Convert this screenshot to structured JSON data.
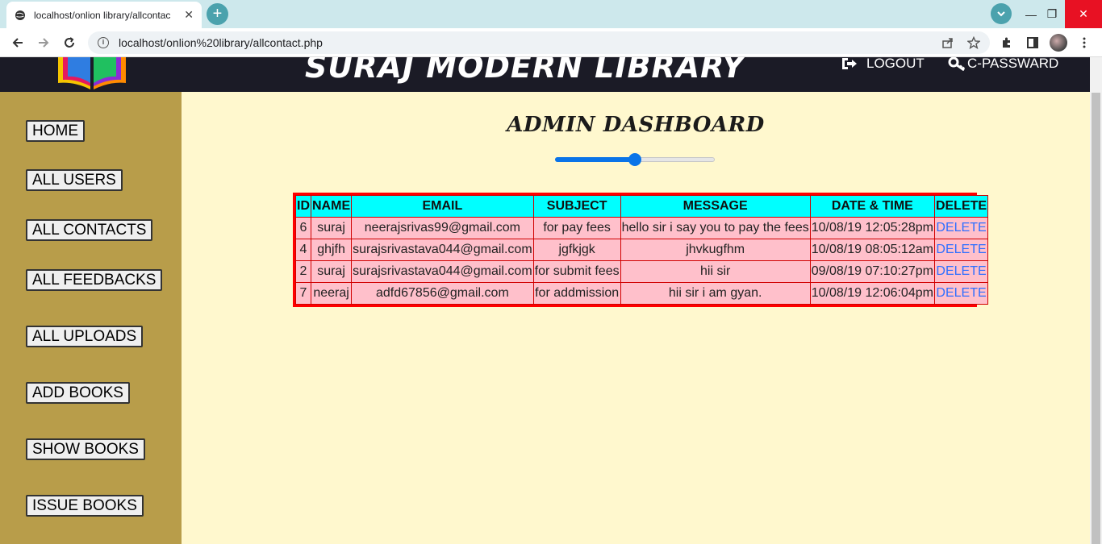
{
  "browser": {
    "tab_title": "localhost/onlion library/allcontac",
    "url": "localhost/onlion%20library/allcontact.php"
  },
  "header": {
    "brand": "SURAJ MODERN LIBRARY",
    "logout": "LOGOUT",
    "change_password": "C-PASSWARD"
  },
  "sidebar": {
    "items": [
      {
        "label": "HOME"
      },
      {
        "label": "ALL USERS"
      },
      {
        "label": "ALL CONTACTS"
      },
      {
        "label": "ALL FEEDBACKS"
      },
      {
        "label": "ALL UPLOADS"
      },
      {
        "label": "ADD BOOKS"
      },
      {
        "label": "SHOW BOOKS"
      },
      {
        "label": "ISSUE BOOKS"
      }
    ]
  },
  "main": {
    "title": "ADMIN DASHBOARD",
    "slider_value": 0.5
  },
  "table": {
    "headers": [
      "ID",
      "NAME",
      "EMAIL",
      "SUBJECT",
      "MESSAGE",
      "DATE & TIME",
      "DELETE"
    ],
    "rows": [
      {
        "id": "6",
        "name": "suraj",
        "email": "neerajsrivas99@gmail.com",
        "subject": "for pay fees",
        "message": "hello sir i say you to pay the fees",
        "datetime": "10/08/19 12:05:28pm",
        "delete": "DELETE"
      },
      {
        "id": "4",
        "name": "ghjfh",
        "email": "surajsrivastava044@gmail.com",
        "subject": "jgfkjgk",
        "message": "jhvkugfhm",
        "datetime": "10/08/19 08:05:12am",
        "delete": "DELETE"
      },
      {
        "id": "2",
        "name": "suraj",
        "email": "surajsrivastava044@gmail.com",
        "subject": "for submit fees",
        "message": "hii sir",
        "datetime": "09/08/19 07:10:27pm",
        "delete": "DELETE"
      },
      {
        "id": "7",
        "name": "neeraj",
        "email": "adfd67856@gmail.com",
        "subject": "for addmission",
        "message": "hii sir i am gyan.",
        "datetime": "10/08/19 12:06:04pm",
        "delete": "DELETE"
      }
    ]
  }
}
